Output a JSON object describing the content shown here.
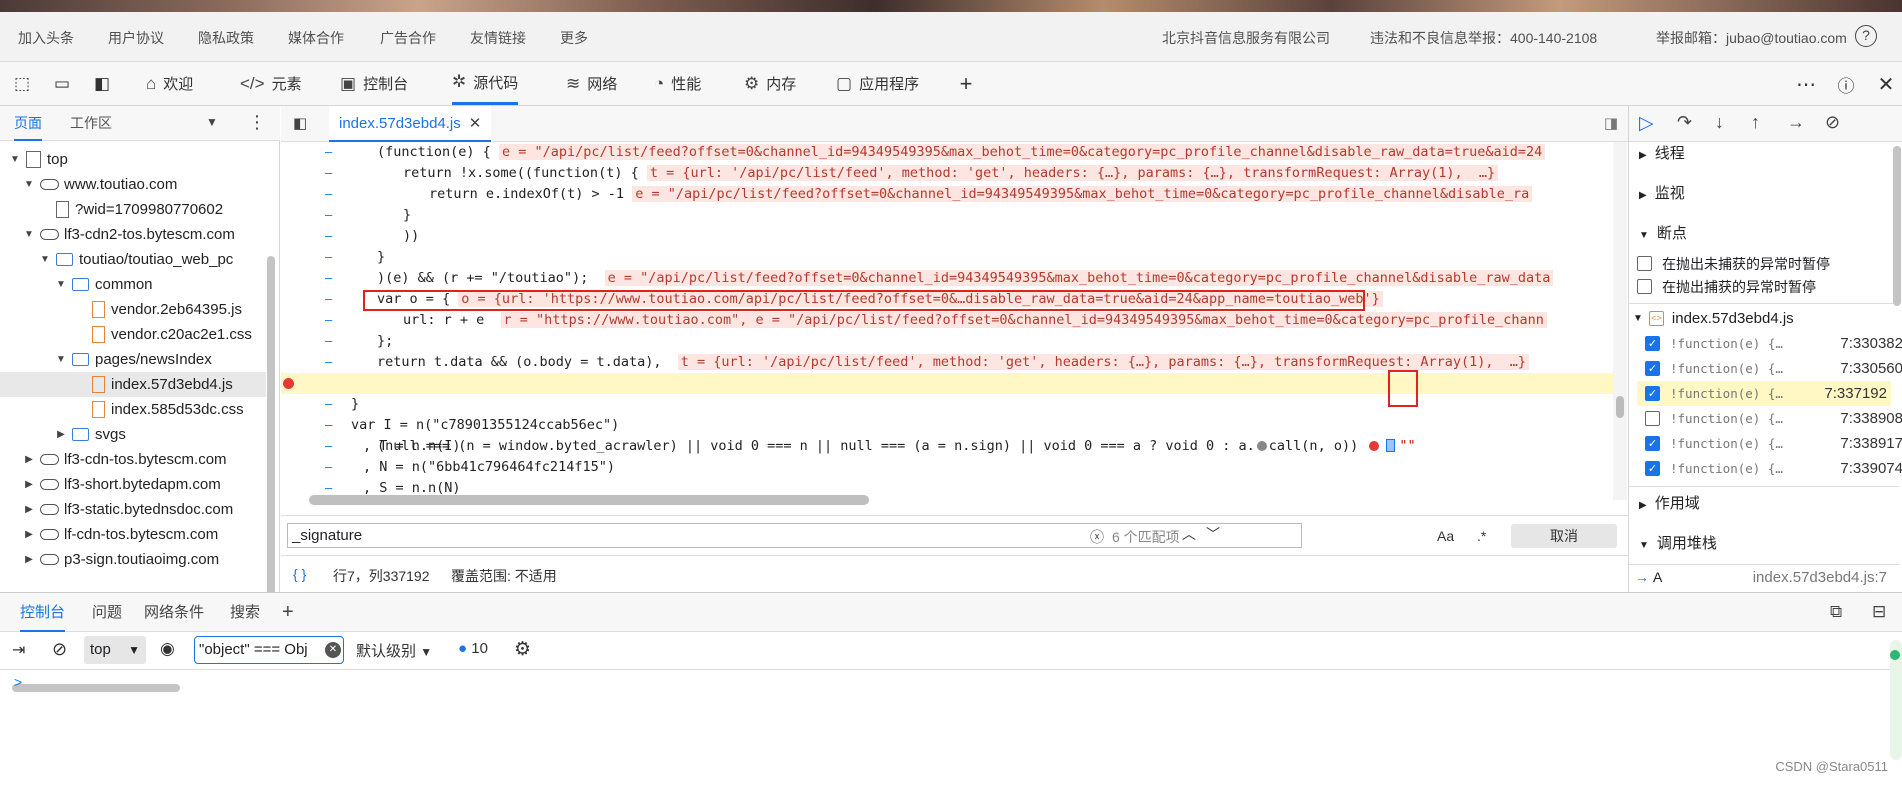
{
  "footer": {
    "links": [
      "加入头条",
      "用户协议",
      "隐私政策",
      "媒体合作",
      "广告合作",
      "友情链接",
      "更多"
    ],
    "company": "北京抖音信息服务有限公司",
    "report": "违法和不良信息举报：400-140-2108",
    "email": "举报邮箱：jubao@toutiao.com"
  },
  "toolbar": {
    "tabs": [
      {
        "label": "欢迎",
        "icon": "home-icon"
      },
      {
        "label": "元素",
        "icon": "code-tags-icon"
      },
      {
        "label": "控制台",
        "icon": "terminal-icon"
      },
      {
        "label": "源代码",
        "icon": "bug-icon"
      },
      {
        "label": "网络",
        "icon": "wifi-icon"
      },
      {
        "label": "性能",
        "icon": "gauge-icon"
      },
      {
        "label": "内存",
        "icon": "chip-icon"
      },
      {
        "label": "应用程序",
        "icon": "window-icon"
      }
    ],
    "active_tab": "源代码"
  },
  "left_panel": {
    "tabs": [
      "页面",
      "工作区"
    ],
    "tree": [
      {
        "label": "top",
        "type": "page"
      },
      {
        "label": "www.toutiao.com",
        "type": "cloud"
      },
      {
        "label": "?wid=1709980770602",
        "type": "doc"
      },
      {
        "label": "lf3-cdn2-tos.bytescm.com",
        "type": "cloud"
      },
      {
        "label": "toutiao/toutiao_web_pc",
        "type": "folder"
      },
      {
        "label": "common",
        "type": "folder"
      },
      {
        "label": "vendor.2eb64395.js",
        "type": "js"
      },
      {
        "label": "vendor.c20ac2e1.css",
        "type": "css"
      },
      {
        "label": "pages/newsIndex",
        "type": "folder"
      },
      {
        "label": "index.57d3ebd4.js",
        "type": "js"
      },
      {
        "label": "index.585d53dc.css",
        "type": "css"
      },
      {
        "label": "svgs",
        "type": "folder"
      },
      {
        "label": "lf3-cdn-tos.bytescm.com",
        "type": "cloud"
      },
      {
        "label": "lf3-short.bytedapm.com",
        "type": "cloud"
      },
      {
        "label": "lf3-static.bytednsdoc.com",
        "type": "cloud"
      },
      {
        "label": "lf-cdn-tos.bytescm.com",
        "type": "cloud"
      },
      {
        "label": "p3-sign.toutiaoimg.com",
        "type": "cloud"
      }
    ]
  },
  "editor": {
    "file_tab": "index.57d3ebd4.js",
    "lines": [
      {
        "code": "(function(e) {",
        "inline": "e = \"/api/pc/list/feed?offset=0&channel_id=94349549395&max_behot_time=0&category=pc_profile_channel&disable_raw_data=true&aid=24"
      },
      {
        "code": "return !x.some((function(t) {",
        "inline": "t = {url: '/api/pc/list/feed', method: 'get', headers: {…}, params: {…}, transformRequest: Array(1),  …}"
      },
      {
        "code": "return e.indexOf(t) > -1",
        "inline": "e = \"/api/pc/list/feed?offset=0&channel_id=94349549395&max_behot_time=0&category=pc_profile_channel&disable_ra"
      },
      {
        "code": "}",
        "inline": ""
      },
      {
        "code": "))",
        "inline": ""
      },
      {
        "code": "}",
        "inline": ""
      },
      {
        "code": ")(e) && (r += \"/toutiao\");",
        "inline": "e = \"/api/pc/list/feed?offset=0&channel_id=94349549395&max_behot_time=0&category=pc_profile_channel&disable_raw_data"
      },
      {
        "code": "var o = {",
        "inline": "o = {url: 'https://www.toutiao.com/api/pc/list/feed?offset=0&…disable_raw_data=true&aid=24&app_name=toutiao_web'}"
      },
      {
        "code": "url: r + e",
        "inline": "r = \"https://www.toutiao.com\", e = \"/api/pc/list/feed?offset=0&channel_id=94349549395&max_behot_time=0&category=pc_profile_chann"
      },
      {
        "code": "};",
        "inline": ""
      },
      {
        "code": "return t.data && (o.body = t.data),",
        "inline": "t = {url: '/api/pc/list/feed', method: 'get', headers: {…}, params: {…}, transformRequest: Array(1),  …}"
      },
      {
        "code": "(null === (n = window.byted_acrawler) || void 0 === n || null === (a = n.sign) || void 0 === a ? void 0 : a.",
        "mid": "call(n, o))",
        "tail": "\"\"",
        "inline": ""
      },
      {
        "code": "}",
        "inline": ""
      },
      {
        "code": "var I = n(\"c78901355124ccab56ec\")",
        "inline": ""
      },
      {
        "code": ", T = n.n(I)",
        "inline": ""
      },
      {
        "code": ", N = n(\"6bb41c796464fc214f15\")",
        "inline": ""
      },
      {
        "code": ", S = n.n(N)",
        "inline": ""
      }
    ],
    "search_value": "_signature",
    "match_count": "6 个匹配项",
    "match_case": "Aa",
    "regex": ".*",
    "cancel": "取消",
    "status_braces": "{ }",
    "status_pos": "行7，列337192",
    "status_coverage": "覆盖范围: 不适用"
  },
  "right_panel": {
    "sections": [
      "线程",
      "监视",
      "断点",
      "作用域",
      "调用堆栈"
    ],
    "exception_options": [
      "在抛出未捕获的异常时暂停",
      "在抛出捕获的异常时暂停"
    ],
    "bp_file": "index.57d3ebd4.js",
    "breakpoints": [
      {
        "fn": "!function(e) {…",
        "loc": "7:330382",
        "checked": true,
        "active": false
      },
      {
        "fn": "!function(e) {…",
        "loc": "7:330560",
        "checked": true,
        "active": false
      },
      {
        "fn": "!function(e) {…",
        "loc": "7:337192",
        "checked": true,
        "active": true
      },
      {
        "fn": "!function(e) {…",
        "loc": "7:338908",
        "checked": false,
        "active": false
      },
      {
        "fn": "!function(e) {…",
        "loc": "7:338917",
        "checked": true,
        "active": false
      },
      {
        "fn": "!function(e) {…",
        "loc": "7:339074",
        "checked": true,
        "active": false
      }
    ],
    "callstack_fn": "A",
    "callstack_loc": "index.57d3ebd4.js:7"
  },
  "drawer": {
    "tabs": [
      "控制台",
      "问题",
      "网络条件",
      "搜索"
    ],
    "context": "top",
    "filter_value": "\"object\" === Obj",
    "level": "默认级别",
    "issues": "10",
    "prompt": ">"
  },
  "watermark": "CSDN @Stara0511",
  "colors": {
    "accent": "#1a73e8",
    "highlight_line": "#fff8c5",
    "breakpoint": "#e53935",
    "annotation_box": "#e0241b"
  }
}
